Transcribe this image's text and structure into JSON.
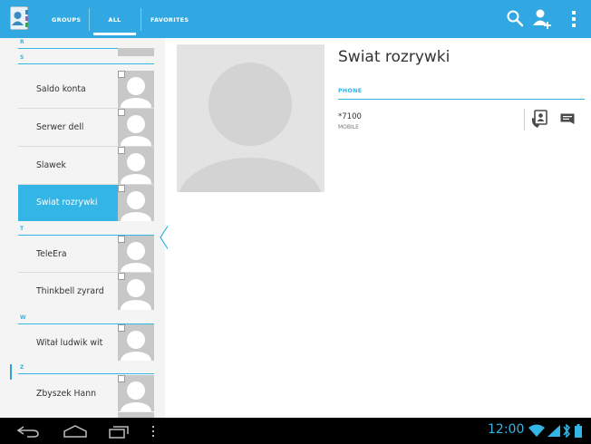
{
  "action_bar": {
    "app_icon": "contacts-app-icon",
    "tabs": [
      {
        "label": "GROUPS",
        "selected": false
      },
      {
        "label": "ALL",
        "selected": true
      },
      {
        "label": "FAVORITES",
        "selected": false
      }
    ],
    "actions": [
      "search-icon",
      "add-contact-icon",
      "overflow-menu-icon"
    ],
    "color": "#31a8e1"
  },
  "contact_list": {
    "headers": [
      "R",
      "S",
      "T",
      "W",
      "Z"
    ],
    "contacts": [
      {
        "name": "Saldo konta",
        "selected": false
      },
      {
        "name": "Serwer dell",
        "selected": false
      },
      {
        "name": "Slawek",
        "selected": false
      },
      {
        "name": "Swiat rozrywki",
        "selected": true
      },
      {
        "name": "TeleEra",
        "selected": false
      },
      {
        "name": "Thinkbell zyrard",
        "selected": false
      },
      {
        "name": "Witał ludwik wit",
        "selected": false
      },
      {
        "name": "Zbyszek Hann",
        "selected": false
      }
    ],
    "selected_color": "#33b5e5"
  },
  "detail": {
    "name": "Swiat rozrywki",
    "section_header": "PHONE",
    "phone": {
      "number": "*7100",
      "type": "MOBILE"
    },
    "actions": [
      "call-icon",
      "sms-icon"
    ]
  },
  "system_bar": {
    "nav_buttons": [
      "back-icon",
      "home-icon",
      "recent-apps-icon",
      "menu-icon"
    ],
    "time": "12:00",
    "status_icons": [
      "wifi-icon",
      "signal-icon",
      "sync-icon",
      "battery-icon"
    ],
    "accent": "#33b5e5"
  }
}
